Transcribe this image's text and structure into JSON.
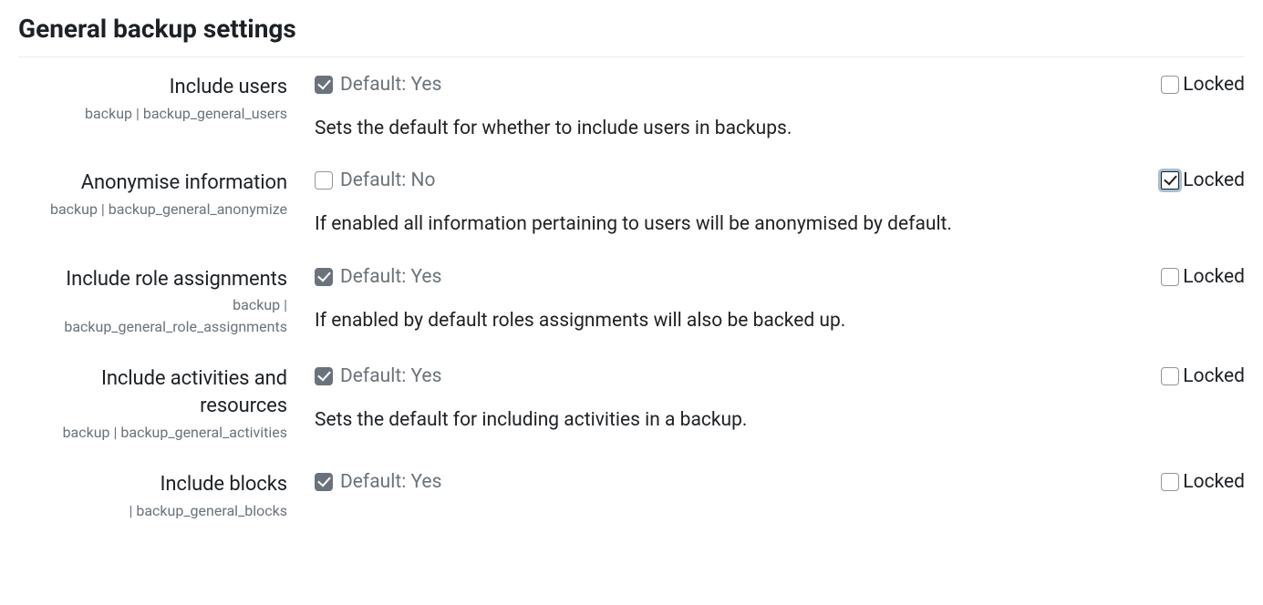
{
  "heading": "General backup settings",
  "locked_label": "Locked",
  "default_prefix": "Default:",
  "settings": [
    {
      "label": "Include users",
      "name": "backup | backup_general_users",
      "default_checked": true,
      "default_value": "Yes",
      "description": "Sets the default for whether to include users in backups.",
      "locked_checked": false,
      "locked_focus": false
    },
    {
      "label": "Anonymise information",
      "name": "backup | backup_general_anonymize",
      "default_checked": false,
      "default_value": "No",
      "description": "If enabled all information pertaining to users will be anonymised by default.",
      "locked_checked": true,
      "locked_focus": true
    },
    {
      "label": "Include role assignments",
      "name": "backup | backup_general_role_assignments",
      "default_checked": true,
      "default_value": "Yes",
      "description": "If enabled by default roles assignments will also be backed up.",
      "locked_checked": false,
      "locked_focus": false
    },
    {
      "label": "Include activities and resources",
      "name": "backup | backup_general_activities",
      "default_checked": true,
      "default_value": "Yes",
      "description": "Sets the default for including activities in a backup.",
      "locked_checked": false,
      "locked_focus": false
    },
    {
      "label": "Include blocks",
      "name": "| backup_general_blocks",
      "default_checked": true,
      "default_value": "Yes",
      "description": "",
      "locked_checked": false,
      "locked_focus": false
    }
  ]
}
